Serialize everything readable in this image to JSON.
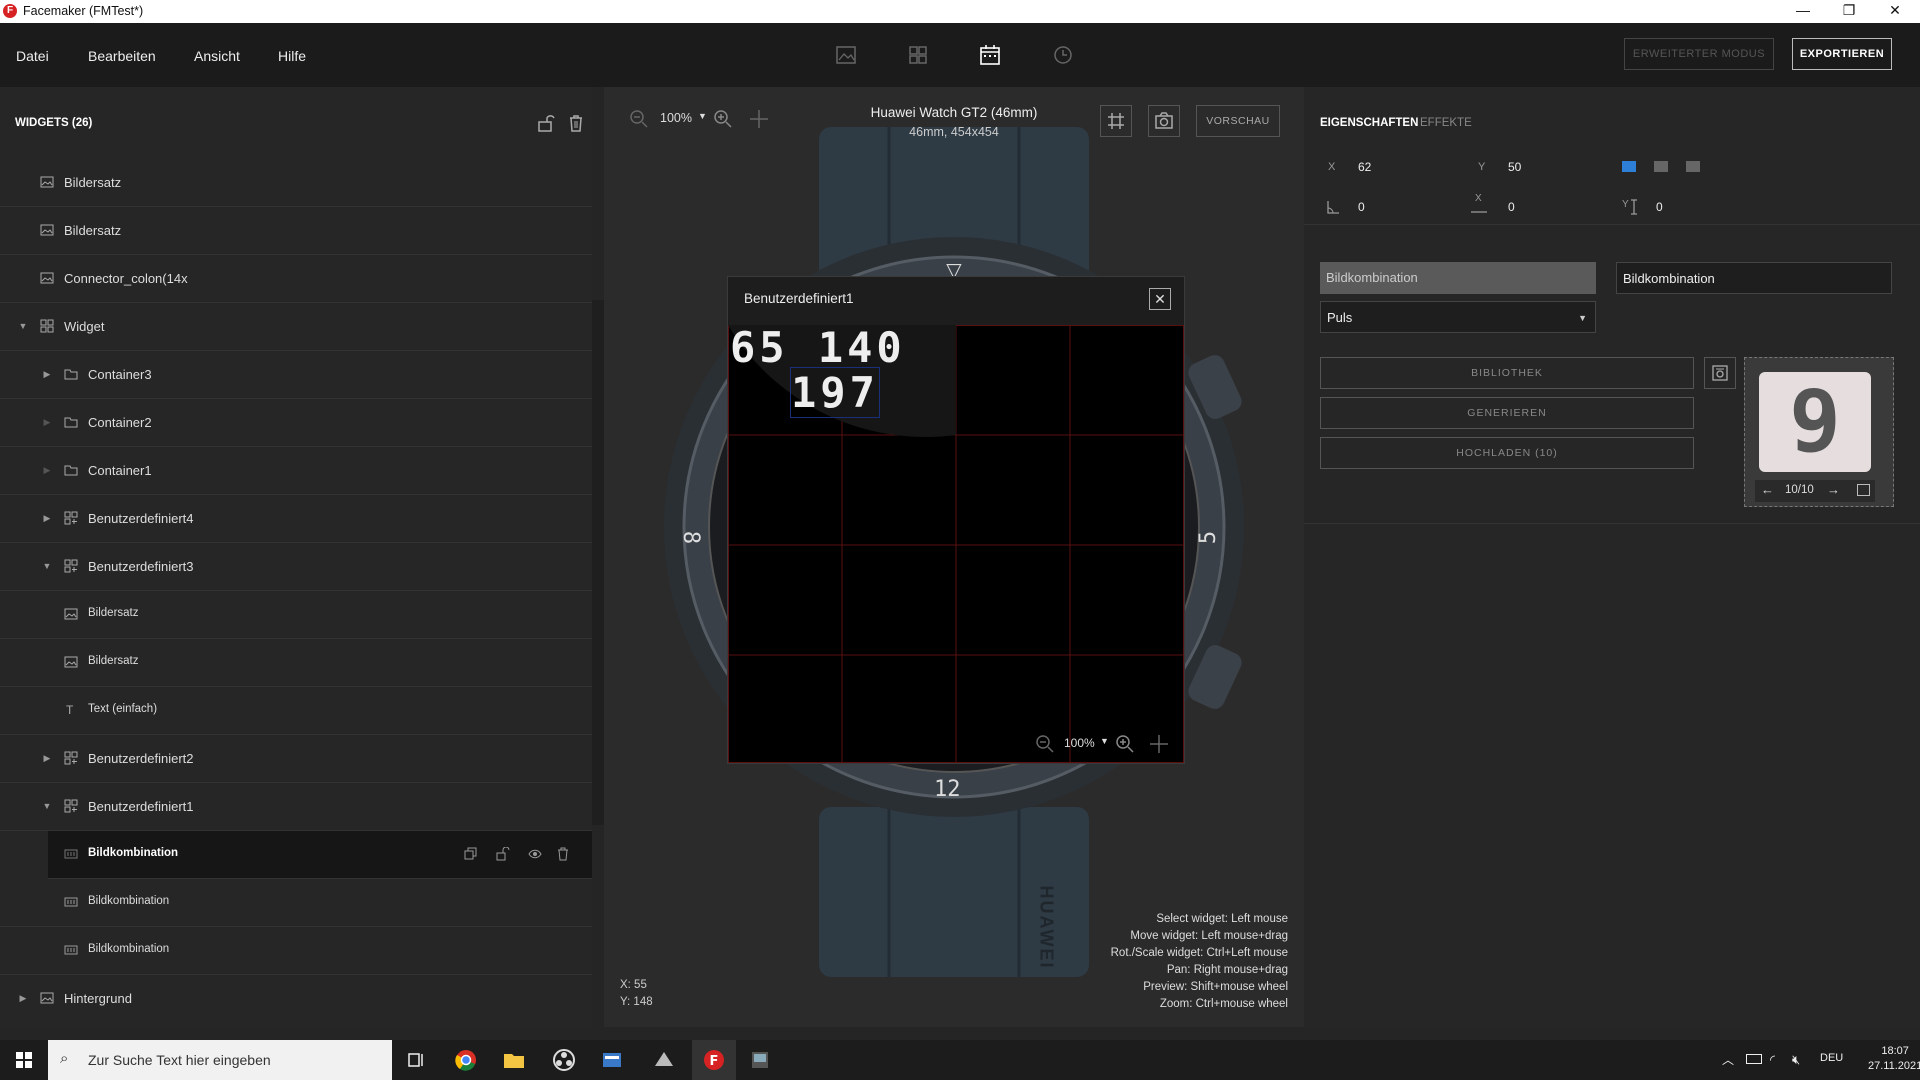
{
  "window": {
    "title": "Facemaker (FMTest*)"
  },
  "menu": {
    "items": [
      "Datei",
      "Bearbeiten",
      "Ansicht",
      "Hilfe"
    ],
    "extended_mode": "ERWEITERTER MODUS",
    "export": "EXPORTIEREN"
  },
  "widgets": {
    "title": "WIDGETS (26)",
    "rows": [
      {
        "label": "Bildersatz"
      },
      {
        "label": "Bildersatz"
      },
      {
        "label": "Connector_colon(14x"
      },
      {
        "label": "Widget"
      },
      {
        "label": "Container3"
      },
      {
        "label": "Container2"
      },
      {
        "label": "Container1"
      },
      {
        "label": "Benutzerdefiniert4"
      },
      {
        "label": "Benutzerdefiniert3"
      },
      {
        "label": "Bildersatz"
      },
      {
        "label": "Bildersatz"
      },
      {
        "label": "Text (einfach)"
      },
      {
        "label": "Benutzerdefiniert2"
      },
      {
        "label": "Benutzerdefiniert1"
      },
      {
        "label": "Bildkombination"
      },
      {
        "label": "Bildkombination"
      },
      {
        "label": "Bildkombination"
      },
      {
        "label": "Hintergrund"
      }
    ]
  },
  "canvas": {
    "zoom": "100%",
    "device_name": "Huawei Watch GT2 (46mm)",
    "device_size": "46mm, 454x454",
    "preview_btn": "VORSCHAU",
    "coord_x": "X: 55",
    "coord_y": "Y: 148",
    "help": [
      "Select widget: Left mouse",
      "Move widget: Left mouse+drag",
      "Rot./Scale widget: Ctrl+Left mouse",
      "Pan: Right mouse+drag",
      "Preview: Shift+mouse wheel",
      "Zoom: Ctrl+mouse wheel"
    ],
    "watch_marks": {
      "left": "8",
      "right": "5",
      "bottom": "12",
      "strap_text": "HUAWEI"
    }
  },
  "dialog": {
    "title": "Benutzerdefiniert1",
    "digits_line1": "65 140",
    "digits_line2": "197",
    "zoom": "100%"
  },
  "properties": {
    "tab_props": "EIGENSCHAFTEN",
    "tab_effects": "EFFEKTE",
    "x_label": "X",
    "x_value": "62",
    "y_label": "Y",
    "y_value": "50",
    "rot_value": "0",
    "scale_x_label": "X",
    "scale_x_value": "0",
    "scale_y_label": "Y",
    "scale_y_value": "0",
    "type_field": "Bildkombination",
    "name_field": "Bildkombination",
    "data_select": "Puls",
    "btn_library": "BIBLIOTHEK",
    "btn_generate": "GENERIEREN",
    "btn_upload": "HOCHLADEN (10)",
    "preview_counter": "10/10",
    "preview_glyph": "9"
  },
  "taskbar": {
    "search_placeholder": "Zur Suche Text hier eingeben",
    "lang": "DEU",
    "time": "18:07",
    "date": "27.11.2021"
  },
  "colors": {
    "accent": "#2d7fd8",
    "app_icon": "#d62222",
    "grid": "#5a1010"
  }
}
